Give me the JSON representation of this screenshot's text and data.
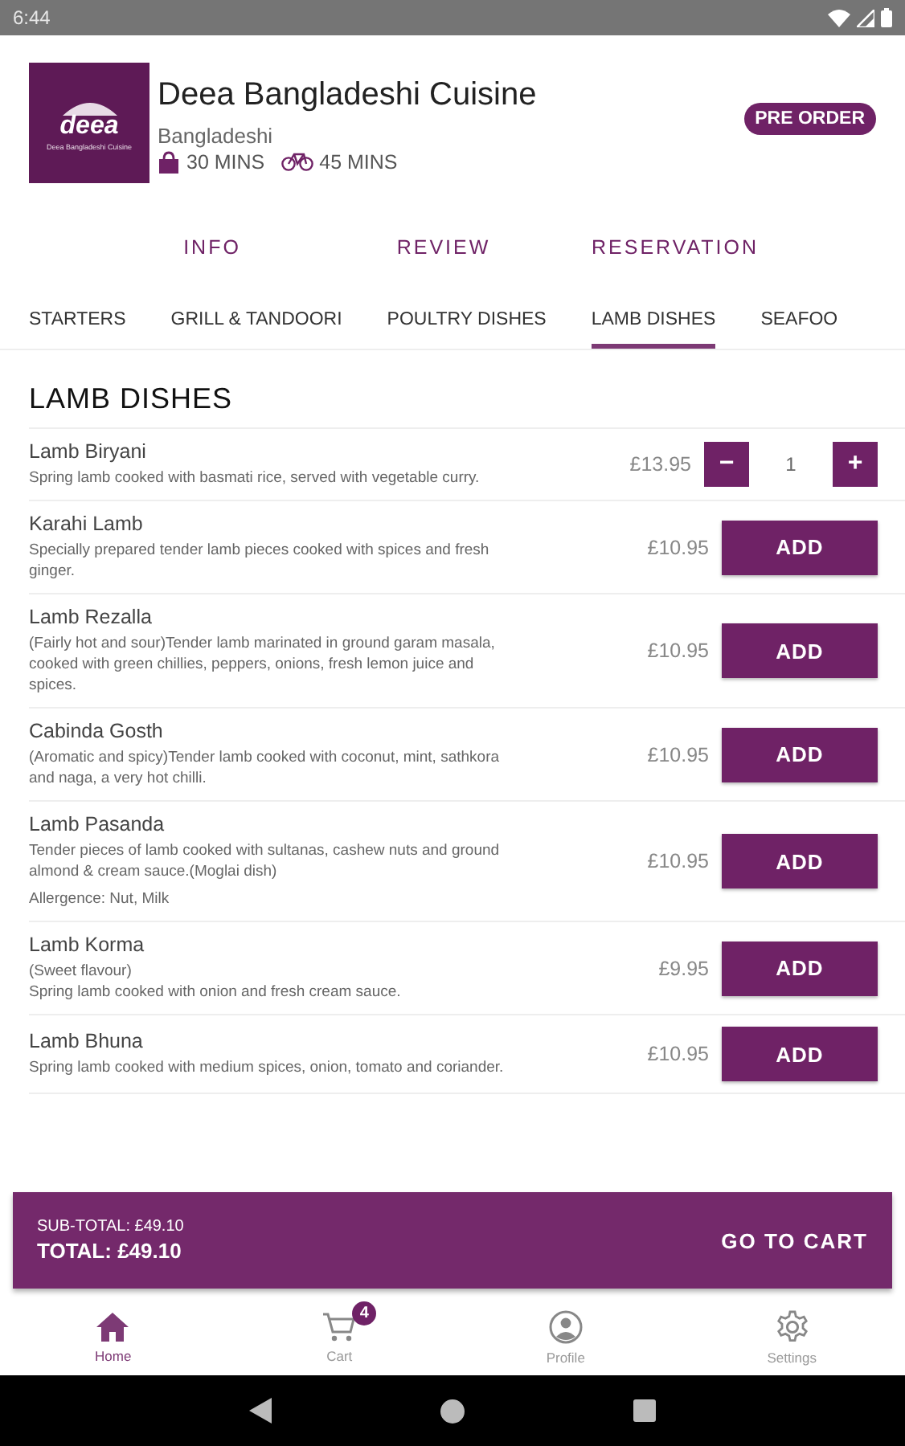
{
  "status_bar": {
    "time": "6:44"
  },
  "restaurant": {
    "logo": {
      "wordmark": "deea",
      "tagline": "Deea Bangladeshi Cuisine"
    },
    "name": "Deea Bangladeshi Cuisine",
    "cuisine": "Bangladeshi",
    "collection_time": "30 MINS",
    "delivery_time": "45 MINS",
    "badge": "PRE ORDER"
  },
  "info_tabs": [
    "INFO",
    "REVIEW",
    "RESERVATION"
  ],
  "categories": [
    {
      "label": "STARTERS",
      "selected": false
    },
    {
      "label": "GRILL & TANDOORI",
      "selected": false
    },
    {
      "label": "POULTRY DISHES",
      "selected": false
    },
    {
      "label": "LAMB DISHES",
      "selected": true
    },
    {
      "label": "SEAFOO",
      "selected": false
    }
  ],
  "section_title": "LAMB DISHES",
  "items": [
    {
      "kind": "stepper",
      "name": "Lamb Biryani",
      "description": "Spring lamb cooked with basmati rice, served with vegetable curry.",
      "price": "£13.95",
      "minus": "−",
      "quantity": "1",
      "plus": "+"
    },
    {
      "kind": "add",
      "name": "Karahi Lamb",
      "description": "Specially prepared tender lamb pieces cooked with spices and fresh ginger.",
      "price": "£10.95",
      "button": "ADD"
    },
    {
      "kind": "add",
      "name": "Lamb Rezalla",
      "description": "(Fairly hot and sour)Tender lamb marinated in ground garam masala, cooked with green chillies, peppers, onions, fresh lemon juice and spices.",
      "price": "£10.95",
      "button": "ADD"
    },
    {
      "kind": "add",
      "name": "Cabinda Gosth",
      "description": "(Aromatic and spicy)Tender lamb cooked with coconut, mint, sathkora and naga, a very hot chilli.",
      "price": "£10.95",
      "button": "ADD"
    },
    {
      "kind": "add",
      "name": "Lamb Pasanda",
      "description": "Tender pieces of lamb cooked with sultanas, cashew nuts and ground almond & cream sauce.(Moglai dish)",
      "allergens": "Allergence: Nut, Milk",
      "price": "£10.95",
      "button": "ADD"
    },
    {
      "kind": "add",
      "name": "Lamb Korma",
      "description": "(Sweet flavour)\nSpring lamb cooked with onion and fresh cream sauce.",
      "price": "£9.95",
      "button": "ADD"
    },
    {
      "kind": "add",
      "name": "Lamb Bhuna",
      "description": "Spring lamb cooked with medium spices, onion, tomato and coriander.",
      "price": "£10.95",
      "button": "ADD"
    }
  ],
  "cart_bar": {
    "subtotal": "SUB-TOTAL: £49.10",
    "total": "TOTAL: £49.10",
    "button": "GO TO CART"
  },
  "bottom_nav": [
    {
      "kind": "home",
      "label": "Home",
      "selected": true
    },
    {
      "kind": "cart",
      "label": "Cart",
      "selected": false,
      "badge": "4"
    },
    {
      "kind": "profile",
      "label": "Profile",
      "selected": false
    },
    {
      "kind": "settings",
      "label": "Settings",
      "selected": false
    }
  ]
}
